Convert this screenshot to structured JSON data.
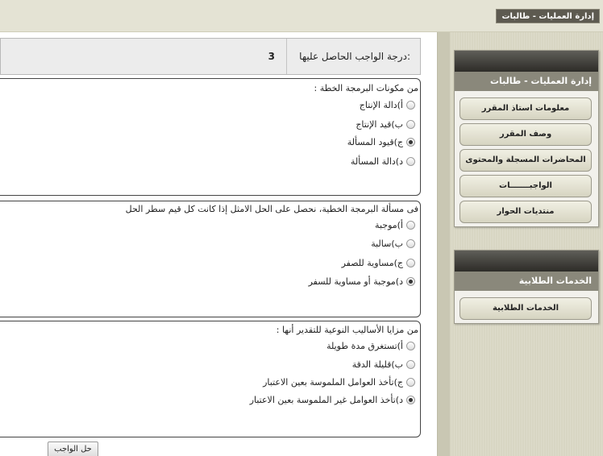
{
  "header": {
    "title": "إدارة العمليات - طالبات"
  },
  "sidebar": {
    "panel1": {
      "title": "إدارة العمليات - طالبات",
      "items": [
        {
          "label": "معلومات استاذ المقرر"
        },
        {
          "label": "وصف المقرر"
        },
        {
          "label": "المحاضرات المسجلة والمحتوى"
        },
        {
          "label": "الواجبـــــــات"
        },
        {
          "label": "منتديات الحوار"
        }
      ]
    },
    "panel2": {
      "title": "الخدمات الطلابية",
      "items": [
        {
          "label": "الخدمات الطلابية"
        }
      ]
    }
  },
  "grade": {
    "label": "درجة الواجب الحاصل عليها:",
    "value": "3"
  },
  "questions": [
    {
      "text": ": من مكونات البرمجة الخطة",
      "options": [
        {
          "label": "أ)دالة الإنتاج",
          "selected": false
        },
        {
          "label": "ب)قيد الإنتاج",
          "selected": false
        },
        {
          "label": "ج)قيود المسألة",
          "selected": true
        },
        {
          "label": "د)دالة المسألة",
          "selected": false
        }
      ]
    },
    {
      "text": "فى مسألة البرمجة الخطية، نحصل على الحل الامثل إذا كانت كل قيم سطر الحل",
      "options": [
        {
          "label": "أ)موجبة",
          "selected": false
        },
        {
          "label": "ب)سالبة",
          "selected": false
        },
        {
          "label": "ج)مساوية للصفر",
          "selected": false
        },
        {
          "label": "د)موجبة أو مساوية للسفر",
          "selected": true
        }
      ]
    },
    {
      "text": ": من مزايا الأساليب النوعية للتقدير أنها",
      "options": [
        {
          "label": "أ)تستغرق مدة طويلة",
          "selected": false
        },
        {
          "label": "ب)قليلة الدقة",
          "selected": false
        },
        {
          "label": "ج)تأخذ العوامل الملموسة بعين الاعتبار",
          "selected": false
        },
        {
          "label": "د)تأخذ العوامل غير الملموسة بعين الاعتبار",
          "selected": true
        }
      ]
    }
  ],
  "actions": {
    "submit_label": "حل الواجب"
  }
}
